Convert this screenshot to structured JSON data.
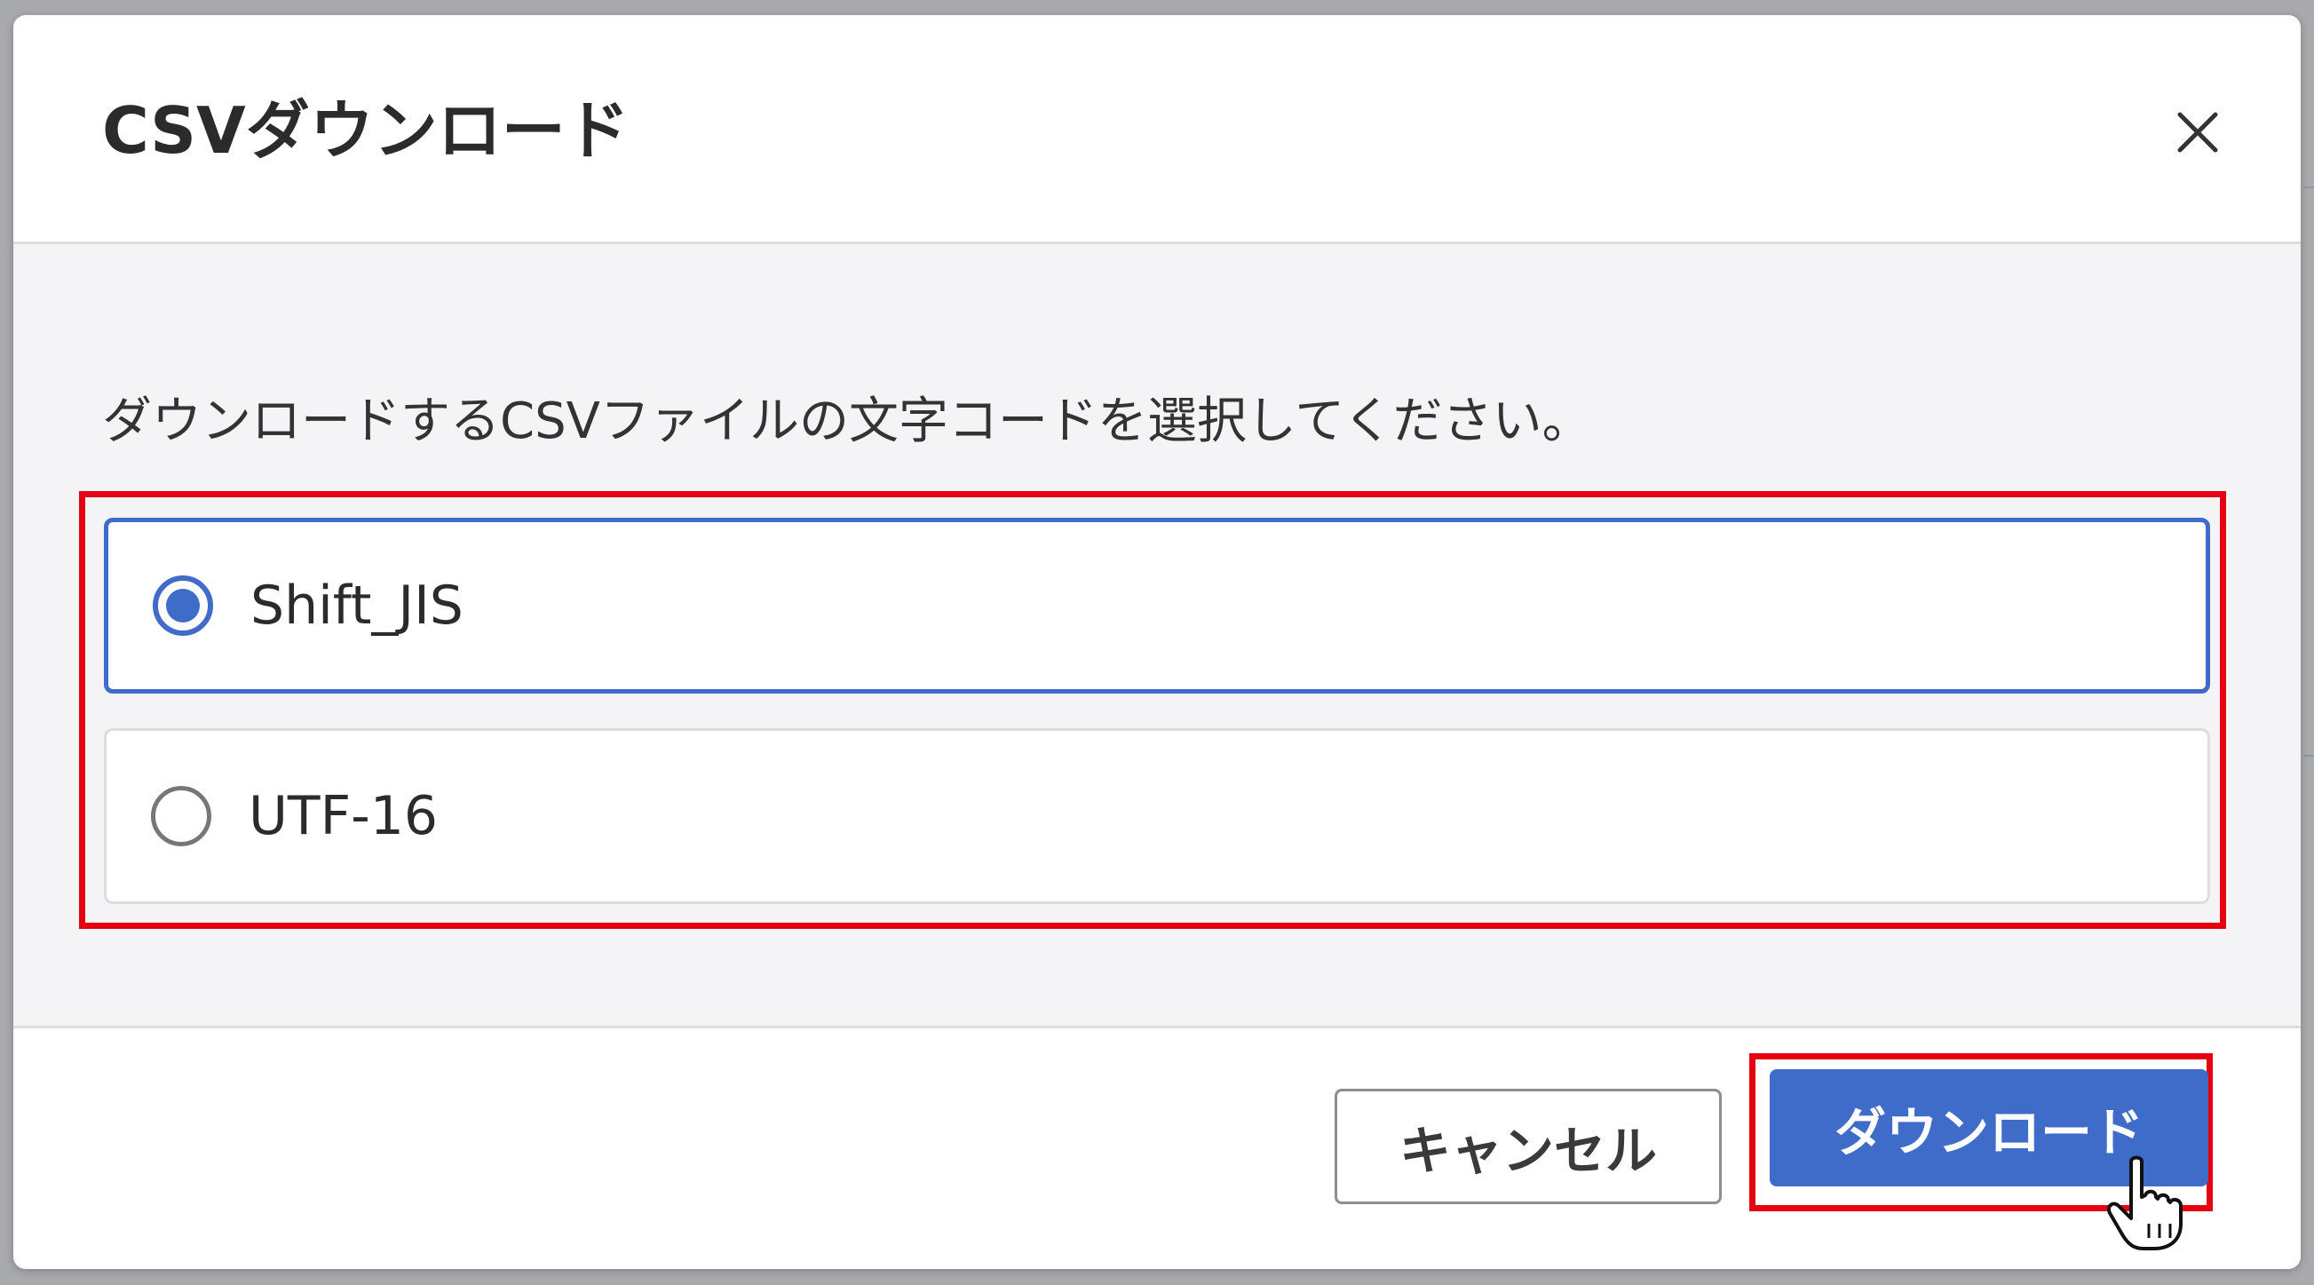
{
  "dialog": {
    "title": "CSVダウンロード",
    "close_icon": "close-icon"
  },
  "body": {
    "instruction": "ダウンロードするCSVファイルの文字コードを選択してください。",
    "options": [
      {
        "label": "Shift_JIS",
        "selected": true
      },
      {
        "label": "UTF-16",
        "selected": false
      }
    ]
  },
  "footer": {
    "cancel_label": "キャンセル",
    "download_label": "ダウンロード"
  },
  "colors": {
    "accent": "#3f6cc9",
    "highlight": "#e60012",
    "overlay": "#a9aaad"
  },
  "icons": {
    "close": "close-icon",
    "pointer": "hand-pointer-icon"
  }
}
